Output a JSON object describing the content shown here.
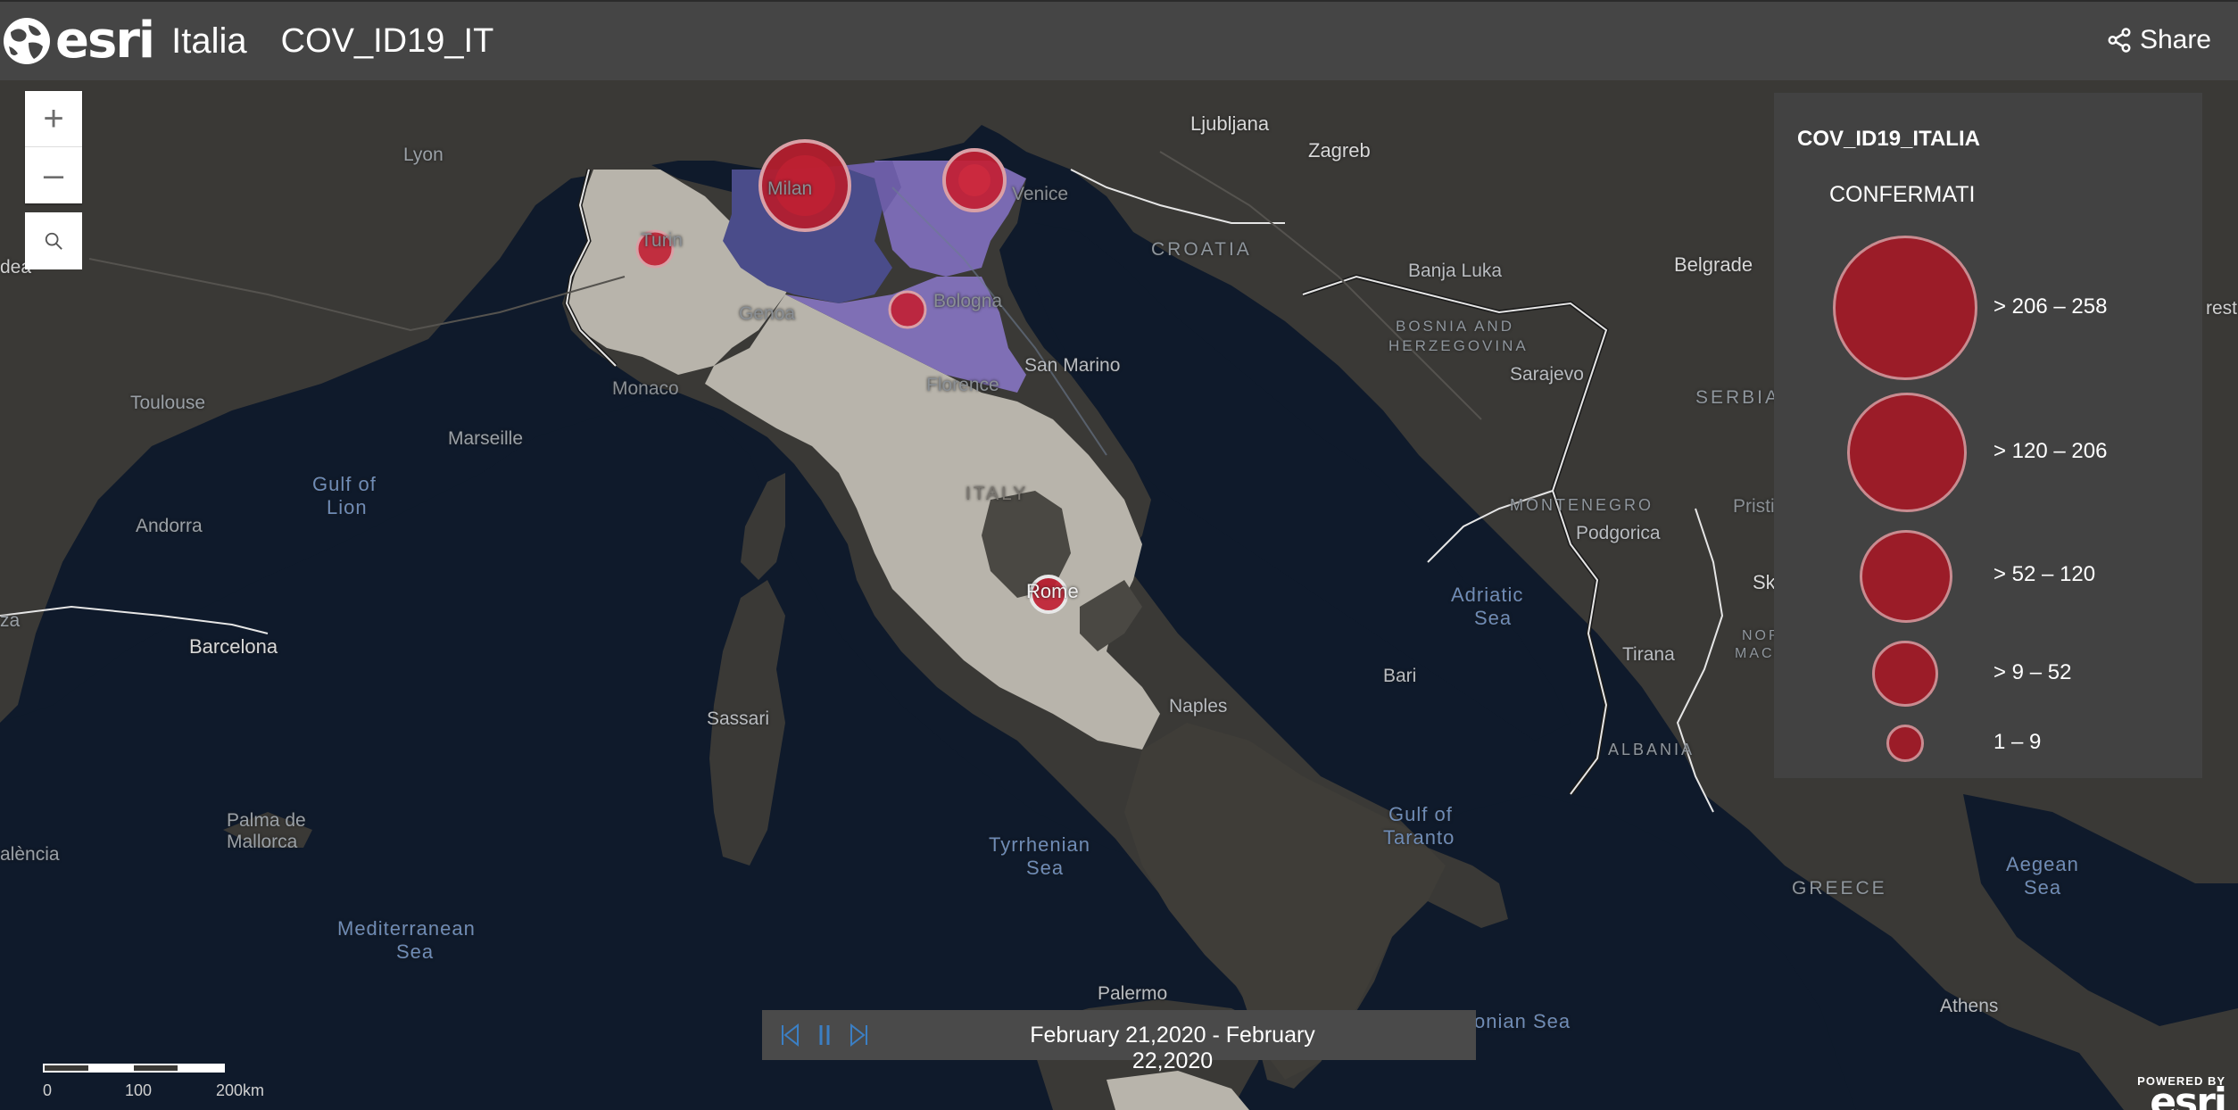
{
  "header": {
    "brand": "esri",
    "org": "Italia",
    "app_title": "COV_ID19_IT",
    "share_label": "Share"
  },
  "map": {
    "labels": {
      "lyon": "Lyon",
      "ljubljana": "Ljubljana",
      "zagreb": "Zagreb",
      "milan": "Milan",
      "venice": "Venice",
      "turin": "Turin",
      "croatia": "CROATIA",
      "banja_luka": "Banja Luka",
      "belgrade": "Belgrade",
      "bologna": "Bologna",
      "genoa": "Genoa",
      "bosnia": "BOSNIA AND",
      "herzegovina": "HERZEGOVINA",
      "san_marino": "San Marino",
      "monaco": "Monaco",
      "florence": "Florence",
      "sarajevo": "Sarajevo",
      "serbia": "SERBIA",
      "toulouse": "Toulouse",
      "marseille": "Marseille",
      "gulf_lion_1": "Gulf of",
      "gulf_lion_2": "Lion",
      "italy": "ITALY",
      "montenegro": "MONTENEGRO",
      "pristina": "Pristin",
      "andorra": "Andorra",
      "podgorica": "Podgorica",
      "adriatic_1": "Adriatic",
      "adriatic_2": "Sea",
      "rome": "Rome",
      "sk": "Sk",
      "za": "za",
      "barcelona": "Barcelona",
      "tirana": "Tirana",
      "nor": "NOR",
      "mace": "MACE",
      "bari": "Bari",
      "naples": "Naples",
      "sassari": "Sassari",
      "albania": "ALBANIA",
      "palma_1": "Palma de",
      "palma_2": "Mallorca",
      "gulf_taranto_1": "Gulf of",
      "gulf_taranto_2": "Taranto",
      "valencia": "alència",
      "tyrrhenian_1": "Tyrrhenian",
      "tyrrhenian_2": "Sea",
      "aegean_1": "Aegean",
      "aegean_2": "Sea",
      "greece": "GREECE",
      "mediterranean_1": "Mediterranean",
      "mediterranean_2": "Sea",
      "palermo": "Palermo",
      "ionian": "onian Sea",
      "athens": "Athens",
      "rest": "rest",
      "dea": "dea"
    }
  },
  "zoom": {
    "in_label": "+",
    "out_label": "–"
  },
  "legend": {
    "title": "COV_ID19_ITALIA",
    "field": "CONFERMATI",
    "items": [
      {
        "label": "> 206 – 258"
      },
      {
        "label": "> 120 – 206"
      },
      {
        "label": "> 52 – 120"
      },
      {
        "label": "> 9 – 52"
      },
      {
        "label": "1 – 9"
      }
    ]
  },
  "time_slider": {
    "range_label": "February 21,2020 - February 22,2020"
  },
  "scalebar": {
    "labels": [
      "0",
      "100",
      "200km"
    ]
  },
  "footer": {
    "powered_by": "POWERED BY",
    "brand": "esri"
  },
  "colors": {
    "header_bg": "#454545",
    "water": "#0f1a2b",
    "land": "#3b3a37",
    "italy_land": "#b9b6ad",
    "lombardy": "#4a4d8c",
    "purple_region": "#7a6ab0",
    "circle_fill": "#c21f33",
    "legend_bg": "#424242"
  }
}
